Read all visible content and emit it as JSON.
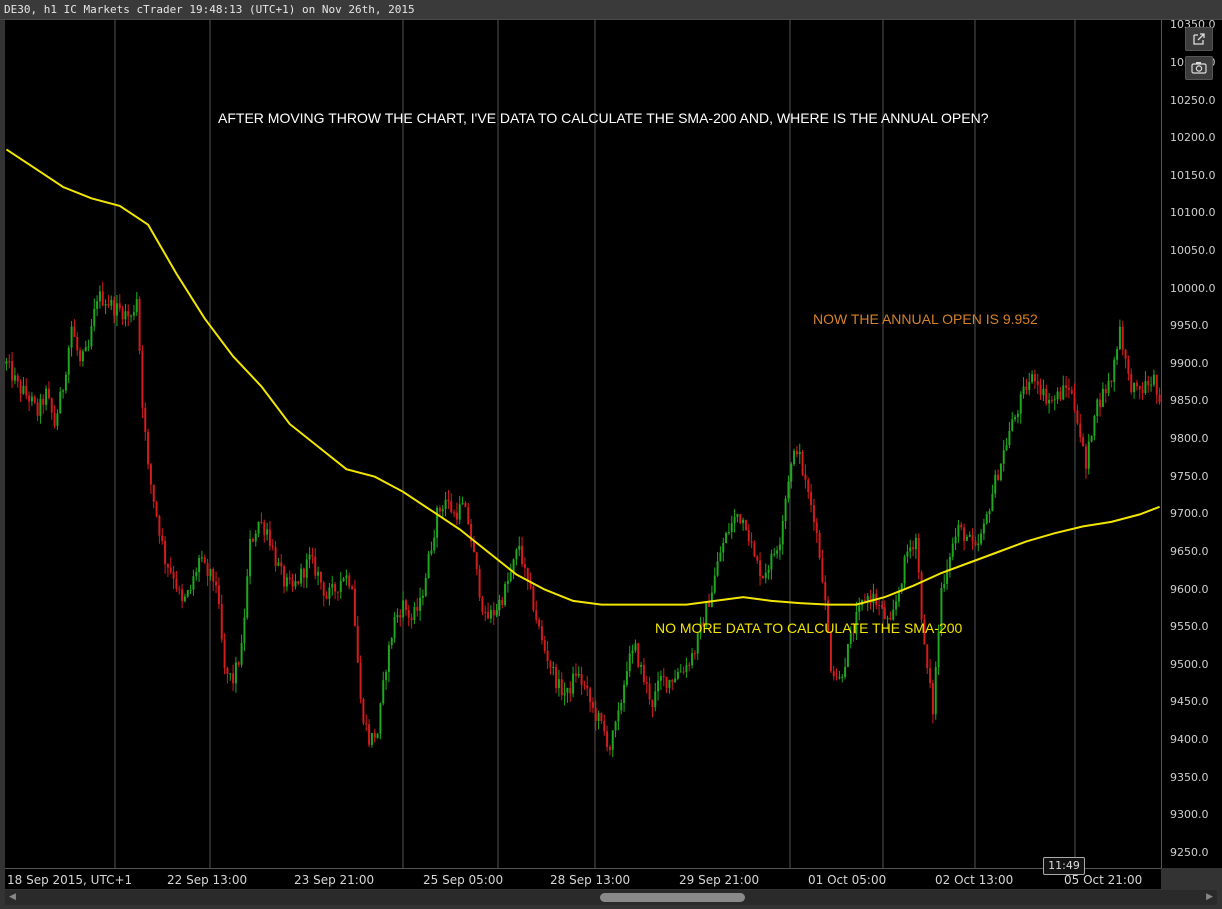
{
  "window": {
    "title": "DE30, h1 IC Markets cTrader 19:48:13 (UTC+1) on Nov 26th, 2015"
  },
  "toolbar": {
    "popout_icon": "external-link-icon",
    "screenshot_icon": "camera-icon"
  },
  "annotations": {
    "top": "AFTER MOVING THROW THE CHART, I'VE DATA TO CALCULATE THE SMA-200 AND, WHERE IS THE ANNUAL OPEN?",
    "annual_open": "NOW THE ANNUAL OPEN IS 9.952",
    "no_data": "NO MORE DATA TO CALCULATE THE SMA-200"
  },
  "time_badge": "11:49",
  "colors": {
    "bull": "#1fa81f",
    "bear": "#d41c1c",
    "sma": "#f2e600",
    "annual_open_text": "#d4822a",
    "no_data_text": "#f2e600",
    "top_text": "#ffffff"
  },
  "chart_data": {
    "type": "candlestick",
    "symbol": "DE30",
    "timeframe": "h1",
    "y_ticks": [
      "9250.0",
      "9300.0",
      "9350.0",
      "9400.0",
      "9450.0",
      "9500.0",
      "9550.0",
      "9600.0",
      "9650.0",
      "9700.0",
      "9750.0",
      "9800.0",
      "9850.0",
      "9900.0",
      "9950.0",
      "10000.0",
      "10050.0",
      "10100.0",
      "10150.0",
      "10200.0",
      "10250.0",
      "10300.0",
      "10350.0"
    ],
    "ylim": [
      9230,
      10357
    ],
    "x_labels": [
      "18 Sep 2015, UTC+1",
      "22 Sep 13:00",
      "23 Sep 21:00",
      "25 Sep 05:00",
      "28 Sep 13:00",
      "29 Sep 21:00",
      "01 Oct 05:00",
      "02 Oct 13:00",
      "05 Oct 21:00"
    ],
    "price_path": [
      [
        0,
        9900
      ],
      [
        4,
        9870
      ],
      [
        8,
        9855
      ],
      [
        11,
        9835
      ],
      [
        14,
        9860
      ],
      [
        17,
        9820
      ],
      [
        20,
        9870
      ],
      [
        23,
        9950
      ],
      [
        26,
        9900
      ],
      [
        29,
        9920
      ],
      [
        32,
        9990
      ],
      [
        35,
        9985
      ],
      [
        38,
        9975
      ],
      [
        41,
        9970
      ],
      [
        44,
        9960
      ],
      [
        46,
        9990
      ],
      [
        48,
        9850
      ],
      [
        50,
        9760
      ],
      [
        53,
        9700
      ],
      [
        56,
        9640
      ],
      [
        59,
        9620
      ],
      [
        62,
        9580
      ],
      [
        65,
        9600
      ],
      [
        68,
        9640
      ],
      [
        71,
        9620
      ],
      [
        74,
        9610
      ],
      [
        77,
        9490
      ],
      [
        80,
        9480
      ],
      [
        83,
        9520
      ],
      [
        86,
        9660
      ],
      [
        89,
        9690
      ],
      [
        92,
        9680
      ],
      [
        95,
        9640
      ],
      [
        98,
        9610
      ],
      [
        101,
        9600
      ],
      [
        104,
        9620
      ],
      [
        107,
        9640
      ],
      [
        110,
        9620
      ],
      [
        113,
        9590
      ],
      [
        116,
        9600
      ],
      [
        119,
        9620
      ],
      [
        122,
        9610
      ],
      [
        125,
        9450
      ],
      [
        128,
        9400
      ],
      [
        131,
        9410
      ],
      [
        134,
        9500
      ],
      [
        137,
        9560
      ],
      [
        140,
        9580
      ],
      [
        143,
        9560
      ],
      [
        146,
        9580
      ],
      [
        149,
        9640
      ],
      [
        152,
        9700
      ],
      [
        155,
        9720
      ],
      [
        158,
        9700
      ],
      [
        161,
        9710
      ],
      [
        163,
        9690
      ],
      [
        166,
        9620
      ],
      [
        169,
        9560
      ],
      [
        172,
        9570
      ],
      [
        175,
        9590
      ],
      [
        178,
        9620
      ],
      [
        181,
        9660
      ],
      [
        183,
        9620
      ],
      [
        186,
        9580
      ],
      [
        189,
        9530
      ],
      [
        192,
        9500
      ],
      [
        195,
        9470
      ],
      [
        198,
        9460
      ],
      [
        201,
        9490
      ],
      [
        204,
        9470
      ],
      [
        207,
        9440
      ],
      [
        210,
        9420
      ],
      [
        213,
        9390
      ],
      [
        216,
        9430
      ],
      [
        219,
        9500
      ],
      [
        222,
        9520
      ],
      [
        225,
        9480
      ],
      [
        228,
        9450
      ],
      [
        231,
        9480
      ],
      [
        234,
        9480
      ],
      [
        237,
        9490
      ],
      [
        240,
        9500
      ],
      [
        243,
        9520
      ],
      [
        246,
        9560
      ],
      [
        249,
        9600
      ],
      [
        252,
        9650
      ],
      [
        255,
        9680
      ],
      [
        258,
        9700
      ],
      [
        261,
        9690
      ],
      [
        264,
        9640
      ],
      [
        267,
        9620
      ],
      [
        270,
        9640
      ],
      [
        273,
        9670
      ],
      [
        276,
        9750
      ],
      [
        279,
        9790
      ],
      [
        282,
        9740
      ],
      [
        285,
        9700
      ],
      [
        288,
        9620
      ],
      [
        291,
        9500
      ],
      [
        294,
        9480
      ],
      [
        297,
        9520
      ],
      [
        300,
        9560
      ],
      [
        303,
        9590
      ],
      [
        306,
        9590
      ],
      [
        309,
        9570
      ],
      [
        312,
        9550
      ],
      [
        315,
        9600
      ],
      [
        318,
        9650
      ],
      [
        321,
        9670
      ],
      [
        324,
        9520
      ],
      [
        327,
        9440
      ],
      [
        330,
        9600
      ],
      [
        333,
        9650
      ],
      [
        336,
        9680
      ],
      [
        339,
        9670
      ],
      [
        342,
        9650
      ],
      [
        345,
        9680
      ],
      [
        348,
        9730
      ],
      [
        351,
        9770
      ],
      [
        354,
        9810
      ],
      [
        357,
        9840
      ],
      [
        360,
        9870
      ],
      [
        363,
        9885
      ],
      [
        366,
        9860
      ],
      [
        369,
        9850
      ],
      [
        372,
        9860
      ],
      [
        375,
        9870
      ],
      [
        378,
        9830
      ],
      [
        381,
        9760
      ],
      [
        384,
        9840
      ],
      [
        387,
        9860
      ],
      [
        390,
        9880
      ],
      [
        393,
        9950
      ],
      [
        396,
        9880
      ],
      [
        399,
        9860
      ],
      [
        402,
        9870
      ],
      [
        405,
        9880
      ],
      [
        407,
        9840
      ]
    ],
    "sma_200": [
      [
        0,
        10185
      ],
      [
        10,
        10160
      ],
      [
        20,
        10135
      ],
      [
        30,
        10120
      ],
      [
        40,
        10110
      ],
      [
        50,
        10085
      ],
      [
        60,
        10020
      ],
      [
        70,
        9960
      ],
      [
        80,
        9910
      ],
      [
        90,
        9870
      ],
      [
        100,
        9820
      ],
      [
        110,
        9790
      ],
      [
        120,
        9760
      ],
      [
        130,
        9750
      ],
      [
        140,
        9730
      ],
      [
        150,
        9705
      ],
      [
        160,
        9680
      ],
      [
        170,
        9650
      ],
      [
        180,
        9620
      ],
      [
        190,
        9600
      ],
      [
        200,
        9585
      ],
      [
        210,
        9580
      ],
      [
        220,
        9580
      ],
      [
        230,
        9580
      ],
      [
        240,
        9580
      ],
      [
        250,
        9585
      ],
      [
        260,
        9590
      ],
      [
        270,
        9585
      ],
      [
        280,
        9582
      ],
      [
        290,
        9580
      ],
      [
        300,
        9580
      ],
      [
        310,
        9590
      ],
      [
        320,
        9605
      ],
      [
        330,
        9622
      ],
      [
        340,
        9636
      ],
      [
        350,
        9650
      ],
      [
        360,
        9664
      ],
      [
        370,
        9675
      ],
      [
        380,
        9684
      ],
      [
        390,
        9690
      ],
      [
        400,
        9700
      ],
      [
        407,
        9710
      ]
    ]
  }
}
